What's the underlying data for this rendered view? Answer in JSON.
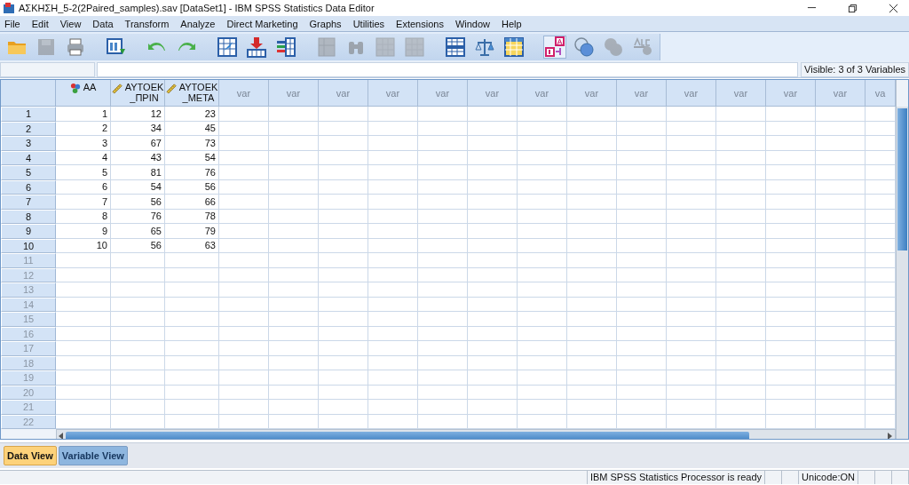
{
  "window": {
    "title": "ΑΣΚΗΣΗ_5-2(2Paired_samples).sav [DataSet1] - IBM SPSS Statistics Data Editor"
  },
  "menu": [
    "File",
    "Edit",
    "View",
    "Data",
    "Transform",
    "Analyze",
    "Direct Marketing",
    "Graphs",
    "Utilities",
    "Extensions",
    "Window",
    "Help"
  ],
  "toolbar": [
    {
      "kind": "open",
      "disabled": false
    },
    {
      "kind": "save",
      "disabled": true
    },
    {
      "kind": "print",
      "disabled": false
    },
    {
      "kind": "dialog",
      "disabled": false
    },
    {
      "kind": "undo",
      "disabled": false
    },
    {
      "kind": "redo",
      "disabled": false
    },
    {
      "kind": "gotocase",
      "disabled": false
    },
    {
      "kind": "gotovar",
      "disabled": false
    },
    {
      "kind": "variables",
      "disabled": false
    },
    {
      "kind": "chart",
      "disabled": true
    },
    {
      "kind": "find",
      "disabled": true
    },
    {
      "kind": "grid",
      "disabled": true
    },
    {
      "kind": "grid",
      "disabled": true
    },
    {
      "kind": "table",
      "disabled": false
    },
    {
      "kind": "scales",
      "disabled": false
    },
    {
      "kind": "yellowtable",
      "disabled": false
    },
    {
      "kind": "labels",
      "disabled": false,
      "selected": true
    },
    {
      "kind": "sets",
      "disabled": false,
      "selected": false
    },
    {
      "kind": "sets",
      "disabled": true,
      "selected": false
    },
    {
      "kind": "spell",
      "disabled": true
    }
  ],
  "visible_label": "Visible: 3 of 3 Variables",
  "table": {
    "columns": [
      {
        "lines": [
          "AA"
        ],
        "kind": "nominal"
      },
      {
        "lines": [
          "ΑΥΤΟΕΚ",
          "_ΠΡΙΝ"
        ],
        "kind": "scale"
      },
      {
        "lines": [
          "ΑΥΤΟΕΚ",
          "_ΜΕΤΑ"
        ],
        "kind": "scale"
      },
      {
        "lines": [
          "var"
        ],
        "kind": "empty"
      },
      {
        "lines": [
          "var"
        ],
        "kind": "empty"
      },
      {
        "lines": [
          "var"
        ],
        "kind": "empty"
      },
      {
        "lines": [
          "var"
        ],
        "kind": "empty"
      },
      {
        "lines": [
          "var"
        ],
        "kind": "empty"
      },
      {
        "lines": [
          "var"
        ],
        "kind": "empty"
      },
      {
        "lines": [
          "var"
        ],
        "kind": "empty"
      },
      {
        "lines": [
          "var"
        ],
        "kind": "empty"
      },
      {
        "lines": [
          "var"
        ],
        "kind": "empty"
      },
      {
        "lines": [
          "var"
        ],
        "kind": "empty"
      },
      {
        "lines": [
          "var"
        ],
        "kind": "empty"
      },
      {
        "lines": [
          "var"
        ],
        "kind": "empty"
      },
      {
        "lines": [
          "var"
        ],
        "kind": "empty"
      },
      {
        "lines": [
          "va"
        ],
        "kind": "empty"
      }
    ],
    "rows": [
      {
        "number": "1",
        "cells": [
          "1",
          "12",
          "23"
        ]
      },
      {
        "number": "2",
        "cells": [
          "2",
          "34",
          "45"
        ]
      },
      {
        "number": "3",
        "cells": [
          "3",
          "67",
          "73"
        ]
      },
      {
        "number": "4",
        "cells": [
          "4",
          "43",
          "54"
        ]
      },
      {
        "number": "5",
        "cells": [
          "5",
          "81",
          "76"
        ]
      },
      {
        "number": "6",
        "cells": [
          "6",
          "54",
          "56"
        ]
      },
      {
        "number": "7",
        "cells": [
          "7",
          "56",
          "66"
        ]
      },
      {
        "number": "8",
        "cells": [
          "8",
          "76",
          "78"
        ]
      },
      {
        "number": "9",
        "cells": [
          "9",
          "65",
          "79"
        ]
      },
      {
        "number": "10",
        "cells": [
          "10",
          "56",
          "63"
        ]
      },
      {
        "number": "11",
        "cells": []
      },
      {
        "number": "12",
        "cells": []
      },
      {
        "number": "13",
        "cells": []
      },
      {
        "number": "14",
        "cells": []
      },
      {
        "number": "15",
        "cells": []
      },
      {
        "number": "16",
        "cells": []
      },
      {
        "number": "17",
        "cells": []
      },
      {
        "number": "18",
        "cells": []
      },
      {
        "number": "19",
        "cells": []
      },
      {
        "number": "20",
        "cells": []
      },
      {
        "number": "21",
        "cells": []
      },
      {
        "number": "22",
        "cells": []
      }
    ]
  },
  "tabs": [
    {
      "label": "Data View",
      "selected": true
    },
    {
      "label": "Variable View",
      "selected": false
    }
  ],
  "status_bar": [
    "IBM SPSS Statistics Processor is ready",
    "Unicode:ON"
  ]
}
